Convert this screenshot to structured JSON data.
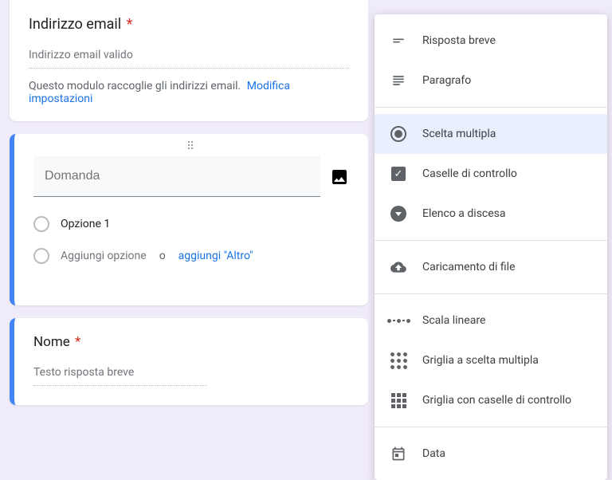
{
  "email_card": {
    "title": "Indirizzo email",
    "required_mark": "*",
    "placeholder": "Indirizzo email valido",
    "helper": "Questo modulo raccoglie gli indirizzi email.",
    "settings_link": "Modifica impostazioni"
  },
  "question_card": {
    "input_placeholder": "Domanda",
    "option1": "Opzione 1",
    "add_option": "Aggiungi opzione",
    "or": "o",
    "add_other": "aggiungi \"Altro\""
  },
  "name_card": {
    "title": "Nome",
    "required_mark": "*",
    "placeholder": "Testo risposta breve"
  },
  "menu": {
    "short_answer": "Risposta breve",
    "paragraph": "Paragrafo",
    "multiple_choice": "Scelta multipla",
    "checkboxes": "Caselle di controllo",
    "dropdown": "Elenco a discesa",
    "file_upload": "Caricamento di file",
    "linear_scale": "Scala lineare",
    "mc_grid": "Griglia a scelta multipla",
    "checkbox_grid": "Griglia con caselle di controllo",
    "date": "Data"
  }
}
